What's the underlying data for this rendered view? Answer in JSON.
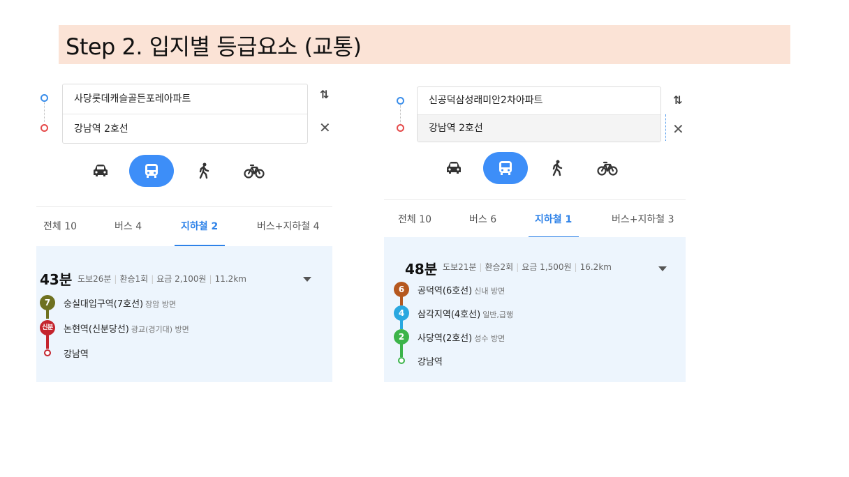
{
  "slide_title": "Step 2. 입지별 등급요소 (교통)",
  "panel1": {
    "origin": "사당롯데캐슬골든포레아파트",
    "destination": "강남역 2호선",
    "modes": [
      "car",
      "bus",
      "walk",
      "bike"
    ],
    "active_mode": "bus",
    "tabs": [
      "전체 10",
      "버스 4",
      "지하철 2",
      "버스+지하철 4"
    ],
    "active_tab": "지하철 2",
    "duration": "43분",
    "meta": [
      "도보26분",
      "환승1회",
      "요금 2,100원",
      "11.2km"
    ],
    "steps": [
      {
        "badge": "7",
        "color": "#6e7120",
        "name": "숭실대입구역(7호선)",
        "direction": "장암 방면"
      },
      {
        "badge": "신분",
        "color": "#c4242d",
        "name": "논현역(신분당선)",
        "direction": "광교(경기대) 방면"
      },
      {
        "badge": "",
        "color": "#c4242d",
        "name": "강남역",
        "direction": ""
      }
    ]
  },
  "panel2": {
    "origin": "신공덕삼성래미안2차아파트",
    "destination": "강남역 2호선",
    "modes": [
      "car",
      "bus",
      "walk",
      "bike"
    ],
    "active_mode": "bus",
    "tabs": [
      "전체 10",
      "버스 6",
      "지하철 1",
      "버스+지하철 3"
    ],
    "active_tab": "지하철 1",
    "duration": "48분",
    "meta": [
      "도보21분",
      "환승2회",
      "요금 1,500원",
      "16.2km"
    ],
    "steps": [
      {
        "badge": "6",
        "color": "#b5581f",
        "name": "공덕역(6호선)",
        "direction": "신내 방면"
      },
      {
        "badge": "4",
        "color": "#2aa8e0",
        "name": "삼각지역(4호선)",
        "direction": "일반,급행"
      },
      {
        "badge": "2",
        "color": "#3cb44a",
        "name": "사당역(2호선)",
        "direction": "성수 방면"
      },
      {
        "badge": "",
        "color": "#3cb44a",
        "name": "강남역",
        "direction": ""
      }
    ]
  },
  "colors": {
    "accent": "#3d8ef8",
    "title_bg": "#fbe3d6",
    "result_bg": "#edf5fd",
    "start_dot": "#3b8eea",
    "end_dot": "#e54b4b"
  },
  "icons": {
    "swap": "swap-vertical-icon",
    "close": "close-icon",
    "car": "car-icon",
    "bus": "bus-icon",
    "walk": "walk-icon",
    "bike": "bike-icon",
    "dropdown": "triangle-down-icon"
  }
}
